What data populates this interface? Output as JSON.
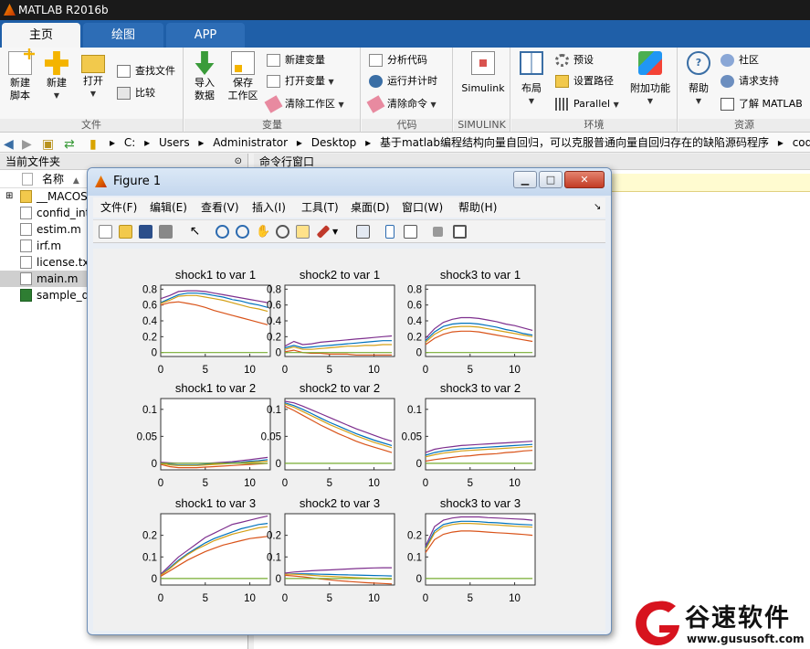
{
  "window": {
    "title": "MATLAB R2016b"
  },
  "tabs": [
    {
      "label": "主页"
    },
    {
      "label": "绘图"
    },
    {
      "label": "APP"
    }
  ],
  "ribbon": {
    "file": {
      "label": "文件",
      "new_script": "新建\n脚本",
      "new": "新建",
      "open": "打开",
      "find_files": "查找文件",
      "compare": "比较"
    },
    "variable": {
      "label": "变量",
      "import": "导入\n数据",
      "save_ws": "保存\n工作区",
      "new_var": "新建变量",
      "open_var": "打开变量",
      "clear_ws": "清除工作区"
    },
    "code": {
      "label": "代码",
      "analyze": "分析代码",
      "run_time": "运行并计时",
      "clear_cmd": "清除命令"
    },
    "simulink": {
      "label": "SIMULINK",
      "simulink": "Simulink"
    },
    "env": {
      "label": "环境",
      "layout": "布局",
      "prefs": "预设",
      "set_path": "设置路径",
      "parallel": "Parallel",
      "addons": "附加功能"
    },
    "resources": {
      "label": "资源",
      "help": "帮助",
      "community": "社区",
      "support": "请求支持",
      "learn": "了解 MATLAB"
    }
  },
  "address": {
    "crumbs": [
      "C:",
      "Users",
      "Administrator",
      "Desktop",
      "基于matlab编程结构向量自回归，可以克服普通向量自回归存在的缺陷源码程序",
      "code"
    ]
  },
  "current_folder": {
    "title": "当前文件夹",
    "col_name": "名称",
    "files": [
      {
        "name": "__MACOS",
        "type": "folder"
      },
      {
        "name": "confid_int.m",
        "type": "m"
      },
      {
        "name": "estim.m",
        "type": "m"
      },
      {
        "name": "irf.m",
        "type": "m"
      },
      {
        "name": "license.txt",
        "type": "txt"
      },
      {
        "name": "main.m",
        "type": "m",
        "selected": true
      },
      {
        "name": "sample_data.xls",
        "type": "xls"
      }
    ]
  },
  "command_window": {
    "title": "命令行窗口"
  },
  "figure": {
    "title": "Figure 1",
    "menu": [
      "文件(F)",
      "编辑(E)",
      "查看(V)",
      "插入(I)",
      "工具(T)",
      "桌面(D)",
      "窗口(W)",
      "帮助(H)"
    ],
    "colors": {
      "purple": "#7e2f8e",
      "blue": "#0072bd",
      "yellow": "#d4a017",
      "orange": "#d95319",
      "green": "#77ac30"
    }
  },
  "chart_data": [
    {
      "type": "line",
      "title": "shock1 to var 1",
      "x": [
        0,
        1,
        2,
        3,
        4,
        5,
        6,
        7,
        8,
        9,
        10,
        11,
        12
      ],
      "ylim": [
        -0.05,
        0.85
      ],
      "yticks": [
        0,
        0.2,
        0.4,
        0.6,
        0.8
      ],
      "xticks": [
        0,
        5,
        10
      ],
      "series": [
        {
          "values": [
            0.68,
            0.72,
            0.77,
            0.78,
            0.78,
            0.77,
            0.75,
            0.73,
            0.71,
            0.69,
            0.67,
            0.65,
            0.63
          ]
        },
        {
          "values": [
            0.63,
            0.68,
            0.73,
            0.75,
            0.75,
            0.74,
            0.72,
            0.7,
            0.67,
            0.65,
            0.62,
            0.6,
            0.57
          ]
        },
        {
          "values": [
            0.62,
            0.66,
            0.71,
            0.72,
            0.72,
            0.7,
            0.68,
            0.66,
            0.63,
            0.6,
            0.57,
            0.55,
            0.52
          ]
        },
        {
          "values": [
            0.6,
            0.63,
            0.64,
            0.62,
            0.6,
            0.57,
            0.53,
            0.5,
            0.47,
            0.44,
            0.41,
            0.38,
            0.35
          ]
        },
        {
          "values": [
            0,
            0,
            0,
            0,
            0,
            0,
            0,
            0,
            0,
            0,
            0,
            0,
            0
          ]
        }
      ]
    },
    {
      "type": "line",
      "title": "shock2 to var 1",
      "x": [
        0,
        1,
        2,
        3,
        4,
        5,
        6,
        7,
        8,
        9,
        10,
        11,
        12
      ],
      "ylim": [
        -0.05,
        0.85
      ],
      "yticks": [
        0,
        0.2,
        0.4,
        0.6,
        0.8
      ],
      "xticks": [
        0,
        5,
        10
      ],
      "series": [
        {
          "values": [
            0.08,
            0.14,
            0.1,
            0.11,
            0.13,
            0.14,
            0.15,
            0.16,
            0.17,
            0.18,
            0.19,
            0.2,
            0.21
          ]
        },
        {
          "values": [
            0.06,
            0.09,
            0.06,
            0.07,
            0.08,
            0.09,
            0.1,
            0.11,
            0.12,
            0.13,
            0.14,
            0.15,
            0.15
          ]
        },
        {
          "values": [
            0.04,
            0.07,
            0.04,
            0.04,
            0.05,
            0.06,
            0.07,
            0.08,
            0.08,
            0.09,
            0.09,
            0.1,
            0.1
          ]
        },
        {
          "values": [
            0.01,
            0.03,
            0.0,
            -0.01,
            -0.01,
            -0.02,
            -0.02,
            -0.02,
            -0.03,
            -0.03,
            -0.03,
            -0.03,
            -0.03
          ]
        },
        {
          "values": [
            0,
            0,
            0,
            0,
            0,
            0,
            0,
            0,
            0,
            0,
            0,
            0,
            0
          ]
        }
      ]
    },
    {
      "type": "line",
      "title": "shock3 to var 1",
      "x": [
        0,
        1,
        2,
        3,
        4,
        5,
        6,
        7,
        8,
        9,
        10,
        11,
        12
      ],
      "ylim": [
        -0.05,
        0.85
      ],
      "yticks": [
        0,
        0.2,
        0.4,
        0.6,
        0.8
      ],
      "xticks": [
        0,
        5,
        10
      ],
      "series": [
        {
          "values": [
            0.18,
            0.3,
            0.38,
            0.42,
            0.44,
            0.44,
            0.43,
            0.41,
            0.39,
            0.36,
            0.34,
            0.31,
            0.28
          ]
        },
        {
          "values": [
            0.15,
            0.26,
            0.33,
            0.36,
            0.37,
            0.37,
            0.36,
            0.34,
            0.32,
            0.29,
            0.27,
            0.24,
            0.22
          ]
        },
        {
          "values": [
            0.13,
            0.23,
            0.29,
            0.32,
            0.33,
            0.33,
            0.32,
            0.3,
            0.28,
            0.26,
            0.24,
            0.22,
            0.2
          ]
        },
        {
          "values": [
            0.1,
            0.18,
            0.23,
            0.26,
            0.27,
            0.27,
            0.26,
            0.24,
            0.22,
            0.2,
            0.18,
            0.16,
            0.14
          ]
        },
        {
          "values": [
            0,
            0,
            0,
            0,
            0,
            0,
            0,
            0,
            0,
            0,
            0,
            0,
            0
          ]
        }
      ]
    },
    {
      "type": "line",
      "title": "shock1 to var 2",
      "x": [
        0,
        1,
        2,
        3,
        4,
        5,
        6,
        7,
        8,
        9,
        10,
        11,
        12
      ],
      "ylim": [
        -0.012,
        0.12
      ],
      "yticks": [
        0,
        0.05,
        0.1
      ],
      "ytick_labels": [
        "0",
        "0.05",
        "0.1"
      ],
      "xticks": [
        0,
        5,
        10
      ],
      "series": [
        {
          "values": [
            0.002,
            0.001,
            0.0,
            0.0,
            0.0,
            0.0,
            0.001,
            0.002,
            0.003,
            0.005,
            0.007,
            0.009,
            0.011
          ]
        },
        {
          "values": [
            0.0,
            -0.002,
            -0.003,
            -0.003,
            -0.003,
            -0.002,
            -0.001,
            0.0,
            0.001,
            0.002,
            0.004,
            0.005,
            0.007
          ]
        },
        {
          "values": [
            0.0,
            -0.003,
            -0.004,
            -0.004,
            -0.004,
            -0.003,
            -0.002,
            -0.001,
            0.0,
            0.001,
            0.002,
            0.003,
            0.004
          ]
        },
        {
          "values": [
            -0.002,
            -0.006,
            -0.008,
            -0.008,
            -0.008,
            -0.007,
            -0.006,
            -0.005,
            -0.004,
            -0.003,
            -0.002,
            -0.001,
            0.0
          ]
        },
        {
          "values": [
            0,
            0,
            0,
            0,
            0,
            0,
            0,
            0,
            0,
            0,
            0,
            0,
            0
          ]
        }
      ]
    },
    {
      "type": "line",
      "title": "shock2 to var 2",
      "x": [
        0,
        1,
        2,
        3,
        4,
        5,
        6,
        7,
        8,
        9,
        10,
        11,
        12
      ],
      "ylim": [
        -0.012,
        0.12
      ],
      "yticks": [
        0,
        0.05,
        0.1
      ],
      "ytick_labels": [
        "0",
        "0.05",
        "0.1"
      ],
      "xticks": [
        0,
        5,
        10
      ],
      "series": [
        {
          "values": [
            0.115,
            0.112,
            0.106,
            0.099,
            0.092,
            0.085,
            0.078,
            0.071,
            0.064,
            0.058,
            0.052,
            0.046,
            0.041
          ]
        },
        {
          "values": [
            0.112,
            0.107,
            0.1,
            0.092,
            0.084,
            0.076,
            0.069,
            0.062,
            0.055,
            0.049,
            0.043,
            0.038,
            0.033
          ]
        },
        {
          "values": [
            0.11,
            0.104,
            0.096,
            0.088,
            0.08,
            0.072,
            0.065,
            0.058,
            0.051,
            0.045,
            0.039,
            0.034,
            0.029
          ]
        },
        {
          "values": [
            0.106,
            0.098,
            0.089,
            0.08,
            0.071,
            0.063,
            0.055,
            0.048,
            0.041,
            0.035,
            0.03,
            0.025,
            0.02
          ]
        },
        {
          "values": [
            0,
            0,
            0,
            0,
            0,
            0,
            0,
            0,
            0,
            0,
            0,
            0,
            0
          ]
        }
      ]
    },
    {
      "type": "line",
      "title": "shock3 to var 2",
      "x": [
        0,
        1,
        2,
        3,
        4,
        5,
        6,
        7,
        8,
        9,
        10,
        11,
        12
      ],
      "ylim": [
        -0.012,
        0.12
      ],
      "yticks": [
        0,
        0.05,
        0.1
      ],
      "ytick_labels": [
        "0",
        "0.05",
        "0.1"
      ],
      "xticks": [
        0,
        5,
        10
      ],
      "series": [
        {
          "values": [
            0.02,
            0.026,
            0.029,
            0.031,
            0.033,
            0.034,
            0.035,
            0.036,
            0.037,
            0.038,
            0.039,
            0.04,
            0.041
          ]
        },
        {
          "values": [
            0.015,
            0.02,
            0.023,
            0.025,
            0.027,
            0.028,
            0.029,
            0.03,
            0.031,
            0.032,
            0.033,
            0.034,
            0.035
          ]
        },
        {
          "values": [
            0.012,
            0.016,
            0.019,
            0.021,
            0.023,
            0.024,
            0.025,
            0.026,
            0.027,
            0.028,
            0.029,
            0.03,
            0.031
          ]
        },
        {
          "values": [
            0.004,
            0.007,
            0.009,
            0.011,
            0.013,
            0.014,
            0.016,
            0.017,
            0.018,
            0.02,
            0.021,
            0.023,
            0.024
          ]
        },
        {
          "values": [
            0,
            0,
            0,
            0,
            0,
            0,
            0,
            0,
            0,
            0,
            0,
            0,
            0
          ]
        }
      ]
    },
    {
      "type": "line",
      "title": "shock1 to var 3",
      "x": [
        0,
        1,
        2,
        3,
        4,
        5,
        6,
        7,
        8,
        9,
        10,
        11,
        12
      ],
      "ylim": [
        -0.03,
        0.3
      ],
      "yticks": [
        0,
        0.1,
        0.2
      ],
      "xticks": [
        0,
        5,
        10
      ],
      "series": [
        {
          "values": [
            0.02,
            0.06,
            0.1,
            0.13,
            0.16,
            0.19,
            0.21,
            0.23,
            0.25,
            0.26,
            0.27,
            0.28,
            0.29
          ]
        },
        {
          "values": [
            0.015,
            0.05,
            0.085,
            0.115,
            0.14,
            0.165,
            0.185,
            0.2,
            0.215,
            0.23,
            0.24,
            0.25,
            0.255
          ]
        },
        {
          "values": [
            0.015,
            0.045,
            0.08,
            0.11,
            0.135,
            0.155,
            0.175,
            0.19,
            0.205,
            0.215,
            0.225,
            0.235,
            0.24
          ]
        },
        {
          "values": [
            0.01,
            0.035,
            0.06,
            0.085,
            0.105,
            0.125,
            0.14,
            0.155,
            0.165,
            0.175,
            0.185,
            0.19,
            0.195
          ]
        },
        {
          "values": [
            0,
            0,
            0,
            0,
            0,
            0,
            0,
            0,
            0,
            0,
            0,
            0,
            0
          ]
        }
      ]
    },
    {
      "type": "line",
      "title": "shock2 to var 3",
      "x": [
        0,
        1,
        2,
        3,
        4,
        5,
        6,
        7,
        8,
        9,
        10,
        11,
        12
      ],
      "ylim": [
        -0.03,
        0.3
      ],
      "yticks": [
        0,
        0.1,
        0.2
      ],
      "xticks": [
        0,
        5,
        10
      ],
      "series": [
        {
          "values": [
            0.025,
            0.03,
            0.033,
            0.036,
            0.038,
            0.04,
            0.042,
            0.044,
            0.046,
            0.048,
            0.049,
            0.05,
            0.05
          ]
        },
        {
          "values": [
            0.02,
            0.022,
            0.022,
            0.021,
            0.02,
            0.019,
            0.018,
            0.017,
            0.016,
            0.015,
            0.014,
            0.013,
            0.012
          ]
        },
        {
          "values": [
            0.02,
            0.02,
            0.018,
            0.015,
            0.012,
            0.01,
            0.008,
            0.006,
            0.004,
            0.002,
            0.0,
            -0.002,
            -0.003
          ]
        },
        {
          "values": [
            0.015,
            0.012,
            0.008,
            0.003,
            -0.002,
            -0.006,
            -0.01,
            -0.013,
            -0.016,
            -0.019,
            -0.021,
            -0.023,
            -0.025
          ]
        },
        {
          "values": [
            0,
            0,
            0,
            0,
            0,
            0,
            0,
            0,
            0,
            0,
            0,
            0,
            0
          ]
        }
      ]
    },
    {
      "type": "line",
      "title": "shock3 to var 3",
      "x": [
        0,
        1,
        2,
        3,
        4,
        5,
        6,
        7,
        8,
        9,
        10,
        11,
        12
      ],
      "ylim": [
        -0.03,
        0.3
      ],
      "yticks": [
        0,
        0.1,
        0.2
      ],
      "xticks": [
        0,
        5,
        10
      ],
      "series": [
        {
          "values": [
            0.15,
            0.24,
            0.27,
            0.28,
            0.285,
            0.285,
            0.285,
            0.282,
            0.28,
            0.278,
            0.276,
            0.274,
            0.27
          ]
        },
        {
          "values": [
            0.14,
            0.22,
            0.25,
            0.26,
            0.265,
            0.265,
            0.263,
            0.26,
            0.258,
            0.255,
            0.252,
            0.25,
            0.248
          ]
        },
        {
          "values": [
            0.135,
            0.21,
            0.24,
            0.25,
            0.255,
            0.255,
            0.253,
            0.25,
            0.248,
            0.245,
            0.242,
            0.24,
            0.238
          ]
        },
        {
          "values": [
            0.12,
            0.18,
            0.205,
            0.215,
            0.22,
            0.22,
            0.218,
            0.215,
            0.212,
            0.21,
            0.207,
            0.204,
            0.2
          ]
        },
        {
          "values": [
            0,
            0,
            0,
            0,
            0,
            0,
            0,
            0,
            0,
            0,
            0,
            0,
            0
          ]
        }
      ]
    }
  ],
  "watermark": {
    "brand": "谷速软件",
    "url": "www.gususoft.com"
  }
}
